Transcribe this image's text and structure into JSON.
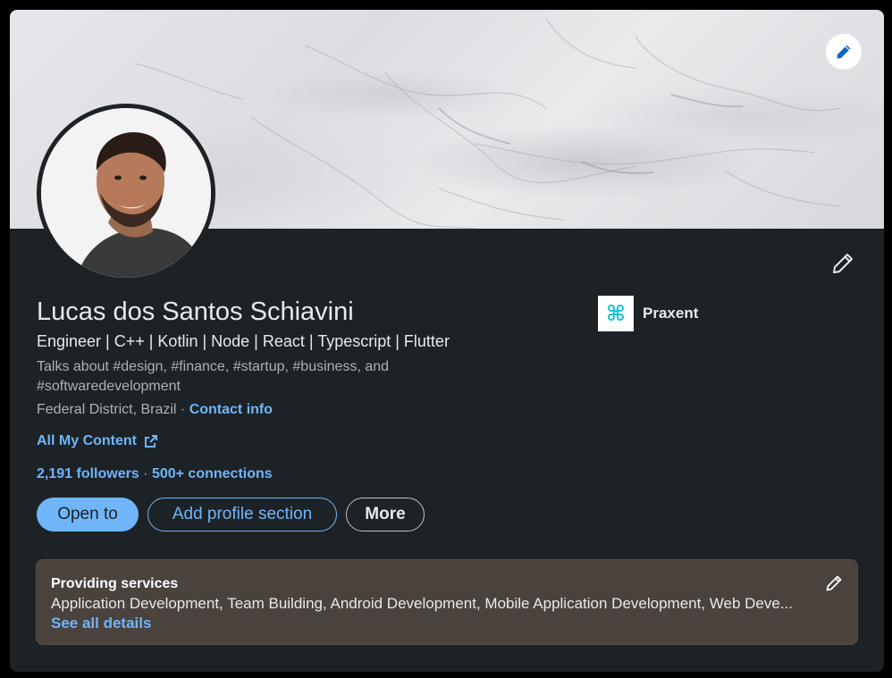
{
  "profile": {
    "name": "Lucas dos Santos Schiavini",
    "headline": "Engineer | C++ | Kotlin | Node | React | Typescript | Flutter",
    "talks_about": "Talks about #design, #finance, #startup, #business, and #softwaredevelopment",
    "location": "Federal District, Brazil",
    "location_separator": " · ",
    "contact_info_label": "Contact info",
    "content_link_label": "All My Content",
    "followers": "2,191 followers",
    "stats_separator": " · ",
    "connections": "500+ connections"
  },
  "company": {
    "name": "Praxent",
    "logo_glyph": "⌘",
    "logo_color": "#1cc2d6"
  },
  "actions": {
    "open_to_label": "Open to",
    "add_section_label": "Add profile section",
    "more_label": "More"
  },
  "services": {
    "title": "Providing services",
    "list": "Application Development, Team Building, Android Development, Mobile Application Development, Web Deve...",
    "details_label": "See all details"
  },
  "icons": {
    "banner_edit": "pencil-icon",
    "intro_edit": "pencil-icon",
    "services_edit": "pencil-icon",
    "external_link": "external-link-icon"
  },
  "colors": {
    "card_background": "#1d2226",
    "accent": "#70b5f9",
    "services_background": "#4a423d"
  }
}
